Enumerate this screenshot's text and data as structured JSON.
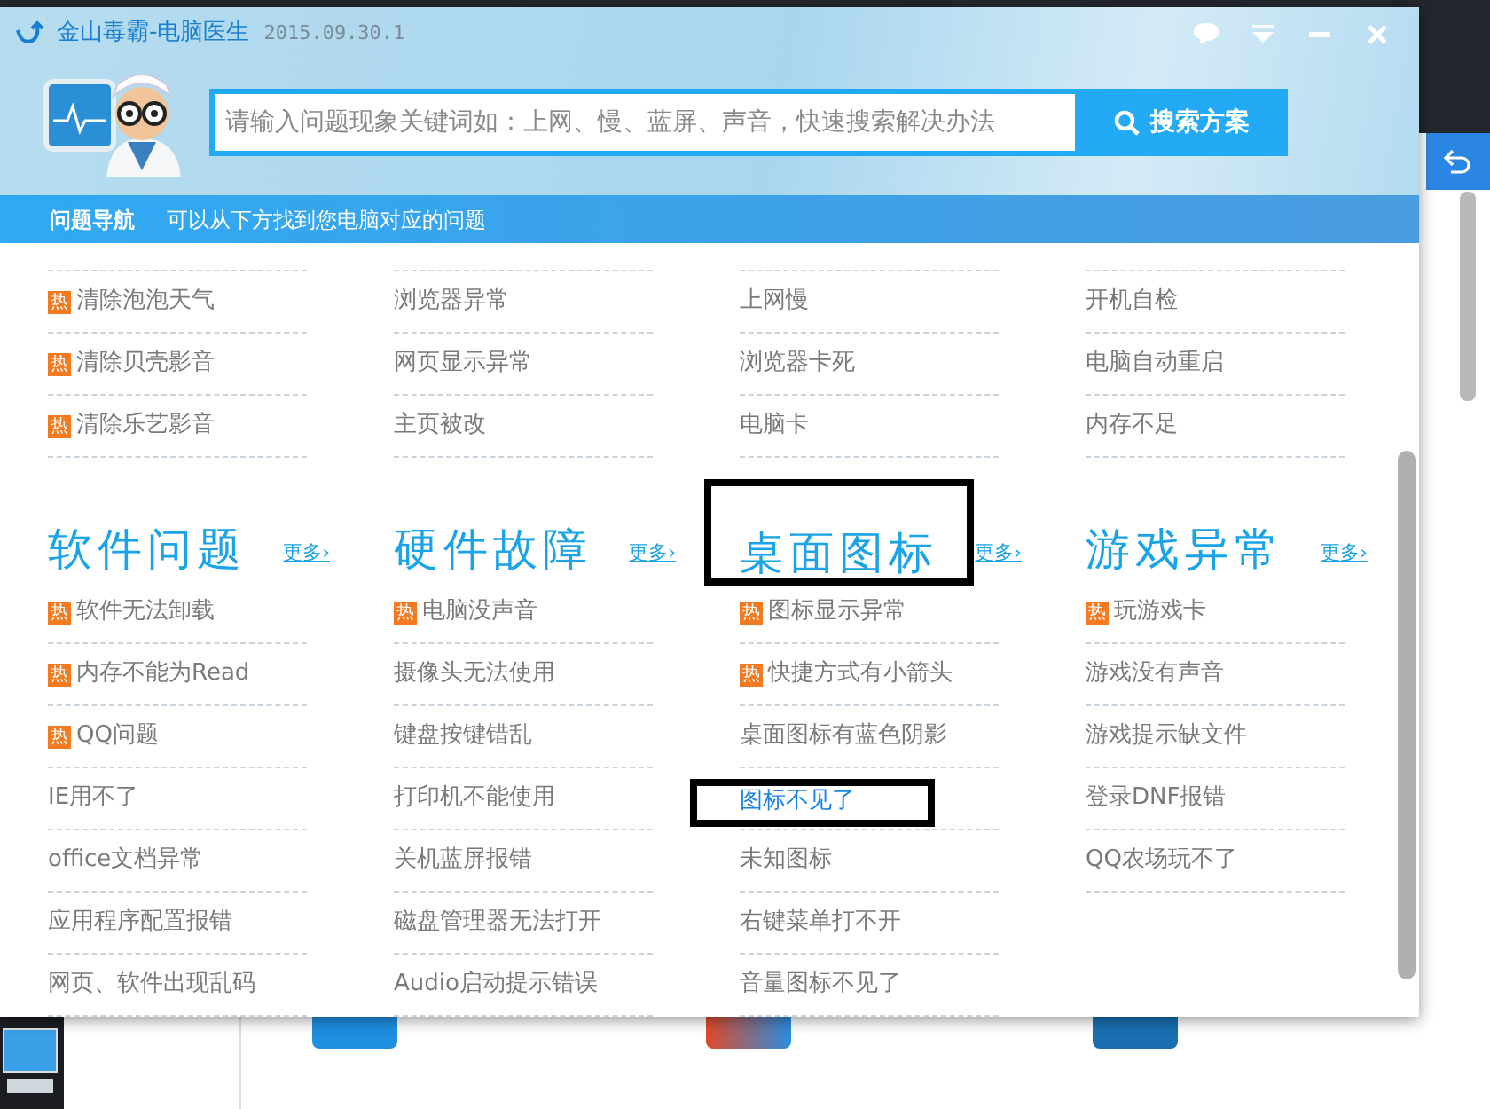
{
  "window": {
    "title": "金山毒霸-电脑医生",
    "version": "2015.09.30.1"
  },
  "search": {
    "placeholder": "请输入问题现象关键词如：上网、慢、蓝屏、声音，快速搜索解决办法",
    "button": "搜索方案"
  },
  "nav": {
    "title": "问题导航",
    "hint": "可以从下方找到您电脑对应的问题"
  },
  "sections": [
    {
      "columns": [
        {
          "items": [
            {
              "text": "清除泡泡天气",
              "hot_badge": "热",
              "selected": false,
              "outlined": false
            },
            {
              "text": "清除贝壳影音",
              "hot_badge": "热",
              "selected": false,
              "outlined": false
            },
            {
              "text": "清除乐艺影音",
              "hot_badge": "热",
              "selected": false,
              "outlined": false
            }
          ]
        },
        {
          "items": [
            {
              "text": "浏览器异常",
              "selected": false,
              "outlined": false
            },
            {
              "text": "网页显示异常",
              "selected": false,
              "outlined": false
            },
            {
              "text": "主页被改",
              "selected": false,
              "outlined": false
            }
          ]
        },
        {
          "items": [
            {
              "text": "上网慢",
              "selected": false,
              "outlined": false
            },
            {
              "text": "浏览器卡死",
              "selected": false,
              "outlined": false
            },
            {
              "text": "电脑卡",
              "selected": false,
              "outlined": false
            }
          ]
        },
        {
          "items": [
            {
              "text": "开机自检",
              "selected": false,
              "outlined": false
            },
            {
              "text": "电脑自动重启",
              "selected": false,
              "outlined": false
            },
            {
              "text": "内存不足",
              "selected": false,
              "outlined": false
            }
          ]
        }
      ]
    },
    {
      "columns": [
        {
          "heading": "软件问题",
          "more": "更多›",
          "outlined": false,
          "items": [
            {
              "text": "软件无法卸载",
              "hot_badge": "热",
              "selected": false,
              "outlined": false
            },
            {
              "text": "内存不能为Read",
              "hot_badge": "热",
              "selected": false,
              "outlined": false
            },
            {
              "text": "QQ问题",
              "hot_badge": "热",
              "selected": false,
              "outlined": false
            },
            {
              "text": "IE用不了",
              "selected": false,
              "outlined": false
            },
            {
              "text": "office文档异常",
              "selected": false,
              "outlined": false
            },
            {
              "text": "应用程序配置报错",
              "selected": false,
              "outlined": false
            },
            {
              "text": "网页、软件出现乱码",
              "selected": false,
              "outlined": false
            }
          ]
        },
        {
          "heading": "硬件故障",
          "more": "更多›",
          "outlined": false,
          "items": [
            {
              "text": "电脑没声音",
              "hot_badge": "热",
              "selected": false,
              "outlined": false
            },
            {
              "text": "摄像头无法使用",
              "selected": false,
              "outlined": false
            },
            {
              "text": "键盘按键错乱",
              "selected": false,
              "outlined": false
            },
            {
              "text": "打印机不能使用",
              "selected": false,
              "outlined": false
            },
            {
              "text": "关机蓝屏报错",
              "selected": false,
              "outlined": false
            },
            {
              "text": "磁盘管理器无法打开",
              "selected": false,
              "outlined": false
            },
            {
              "text": "Audio启动提示错误",
              "selected": false,
              "outlined": false
            }
          ]
        },
        {
          "heading": "桌面图标",
          "more": "更多›",
          "outlined": true,
          "items": [
            {
              "text": "图标显示异常",
              "hot_badge": "热",
              "selected": false,
              "outlined": false
            },
            {
              "text": "快捷方式有小箭头",
              "hot_badge": "热",
              "selected": false,
              "outlined": false
            },
            {
              "text": "桌面图标有蓝色阴影",
              "selected": false,
              "outlined": false
            },
            {
              "text": "图标不见了",
              "selected": true,
              "outlined": true
            },
            {
              "text": "未知图标",
              "selected": false,
              "outlined": false
            },
            {
              "text": "右键菜单打不开",
              "selected": false,
              "outlined": false
            },
            {
              "text": "音量图标不见了",
              "selected": false,
              "outlined": false
            }
          ]
        },
        {
          "heading": "游戏异常",
          "more": "更多›",
          "outlined": false,
          "items": [
            {
              "text": "玩游戏卡",
              "hot_badge": "热",
              "selected": false,
              "outlined": false
            },
            {
              "text": "游戏没有声音",
              "selected": false,
              "outlined": false
            },
            {
              "text": "游戏提示缺文件",
              "selected": false,
              "outlined": false
            },
            {
              "text": "登录DNF报错",
              "selected": false,
              "outlined": false
            },
            {
              "text": "QQ农场玩不了",
              "selected": false,
              "outlined": false
            }
          ]
        }
      ]
    }
  ]
}
